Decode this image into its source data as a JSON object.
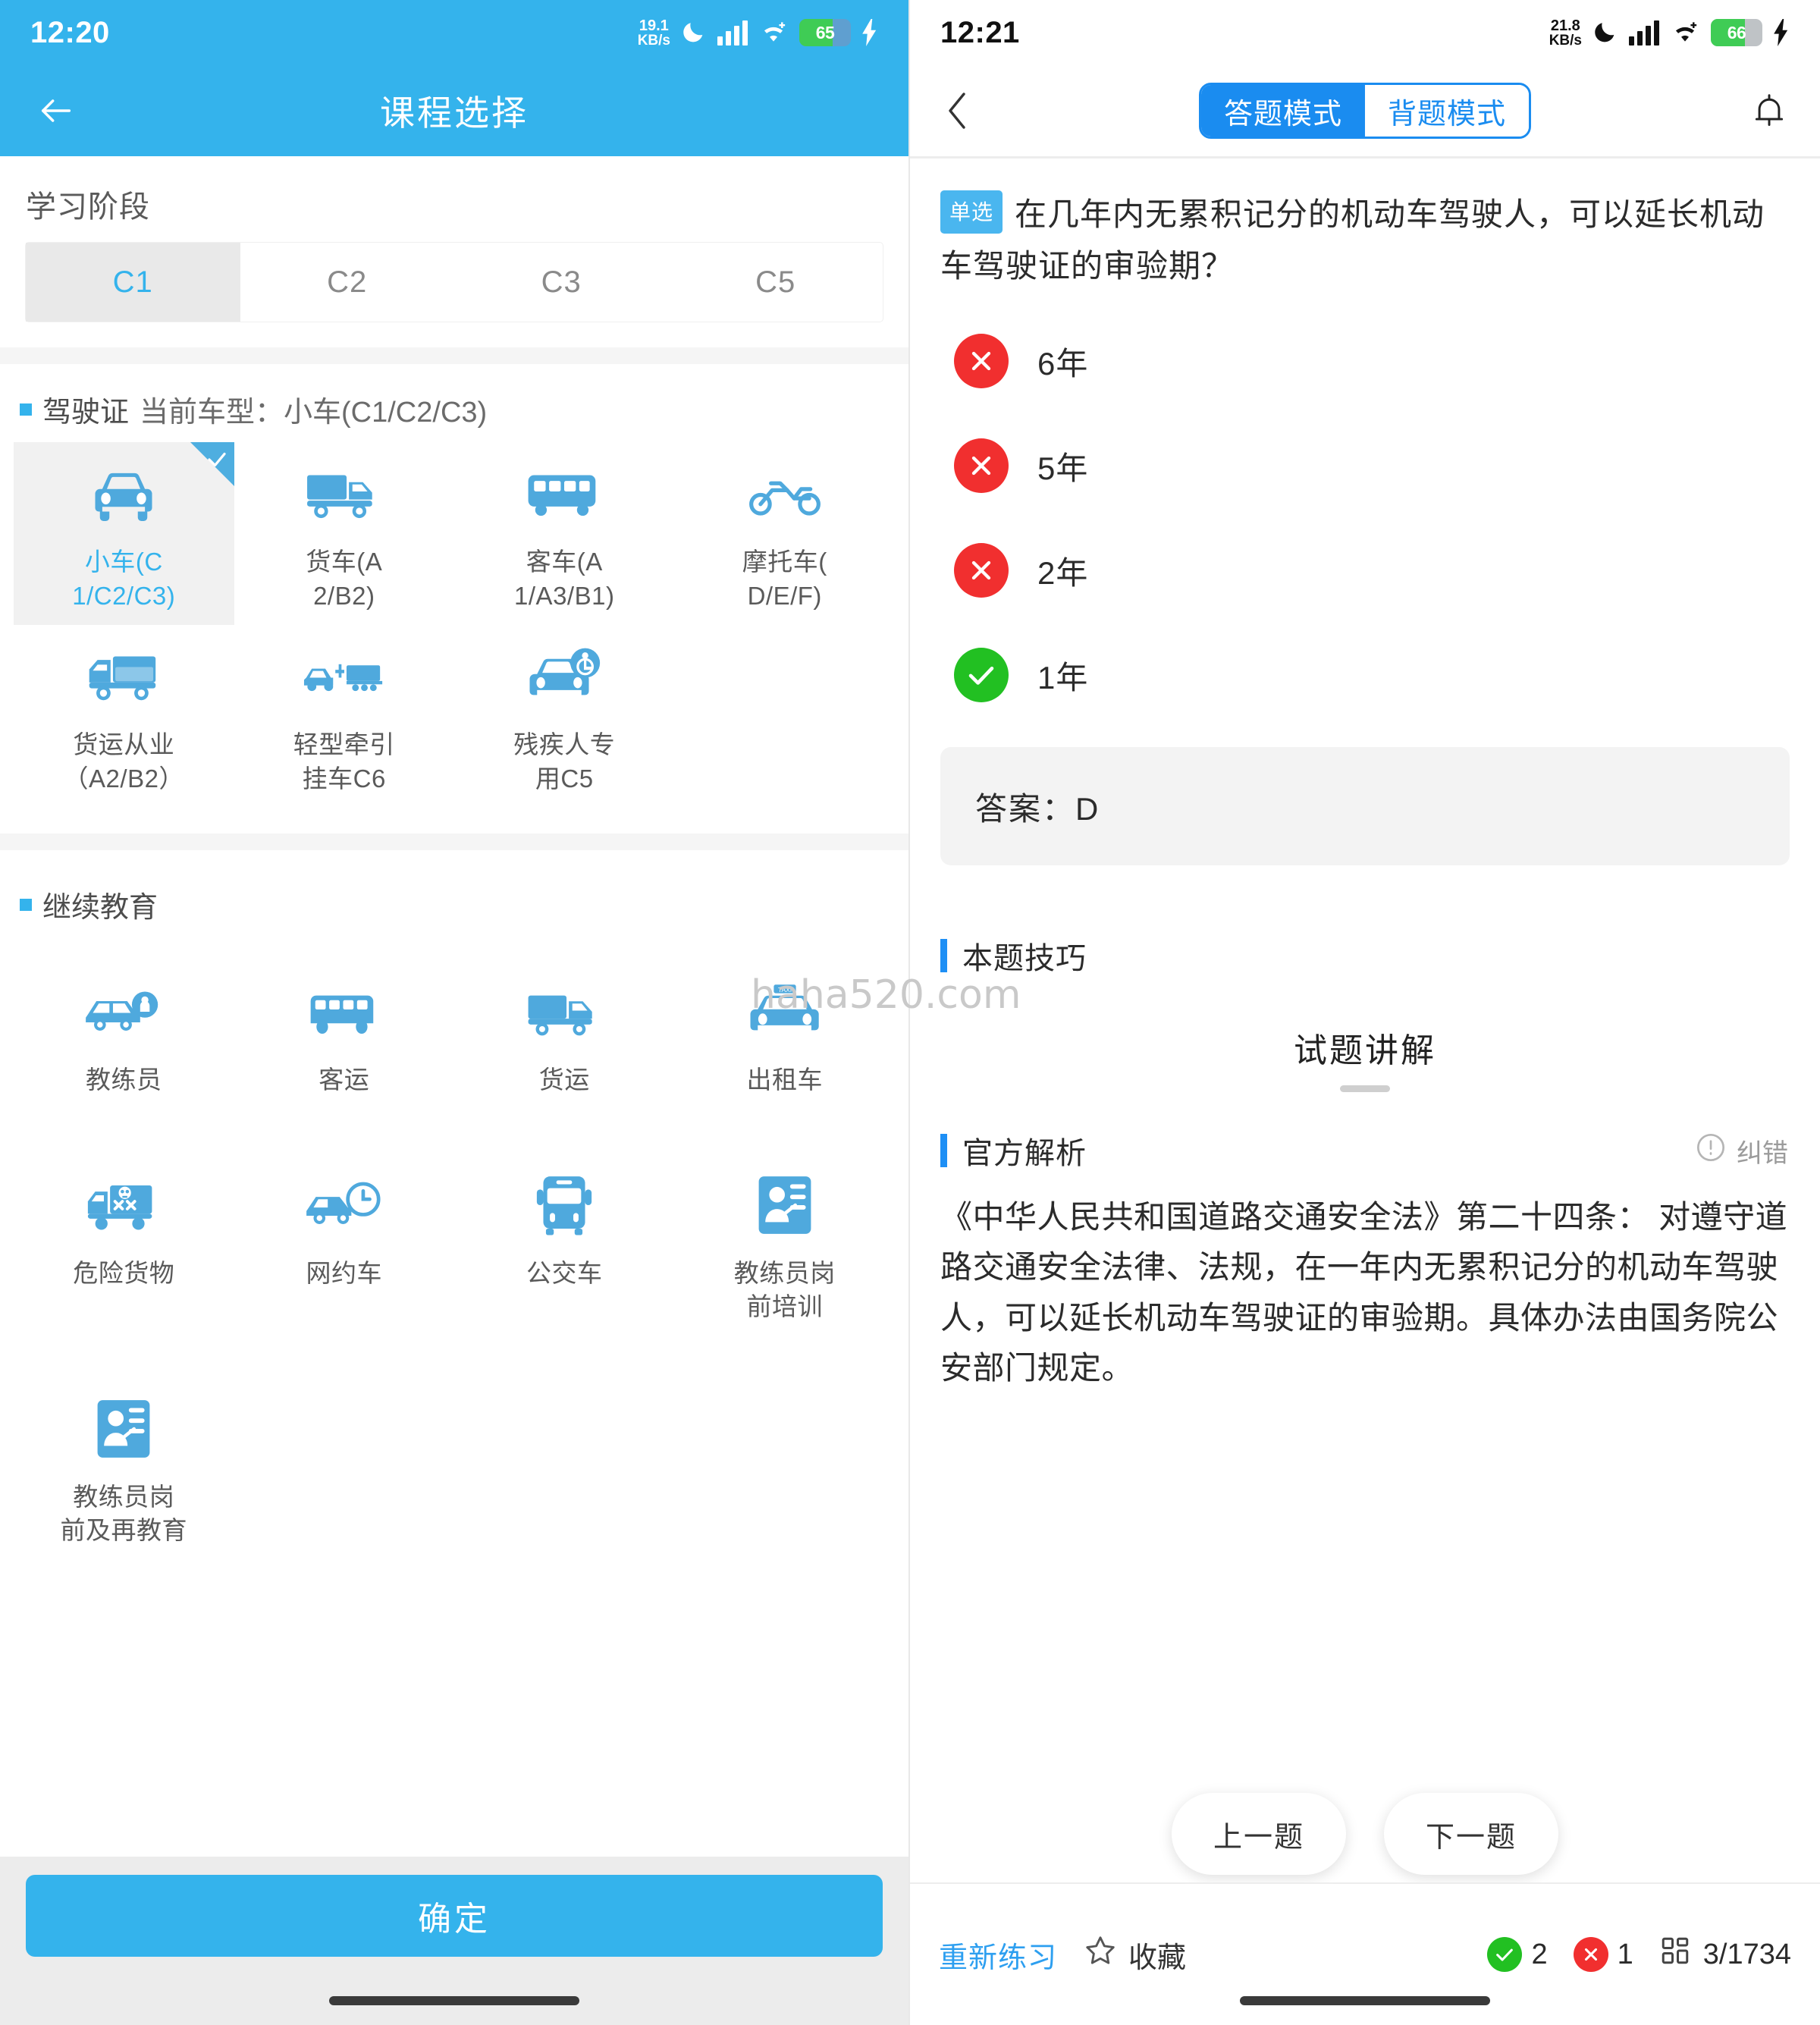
{
  "left": {
    "status": {
      "time": "12:20",
      "net_speed": "19.1",
      "net_unit": "KB/s",
      "battery": "65"
    },
    "appbar": {
      "title": "课程选择",
      "back_icon": "back-arrow-icon"
    },
    "stage": {
      "label": "学习阶段",
      "tabs": [
        {
          "label": "C1",
          "active": true
        },
        {
          "label": "C2",
          "active": false
        },
        {
          "label": "C3",
          "active": false
        },
        {
          "label": "C5",
          "active": false
        }
      ]
    },
    "license_section": {
      "title": "驾驶证",
      "subtitle": "当前车型：小车(C1/C2/C3)",
      "items": [
        {
          "line1": "小车(C",
          "line2": "1/C2/C3)",
          "icon": "car-icon",
          "selected": true
        },
        {
          "line1": "货车(A",
          "line2": "2/B2)",
          "icon": "truck-icon",
          "selected": false
        },
        {
          "line1": "客车(A",
          "line2": "1/A3/B1)",
          "icon": "bus-icon",
          "selected": false
        },
        {
          "line1": "摩托车(",
          "line2": "D/E/F)",
          "icon": "motorcycle-icon",
          "selected": false
        },
        {
          "line1": "货运从业",
          "line2": "（A2/B2）",
          "icon": "cargo-truck-icon",
          "selected": false
        },
        {
          "line1": "轻型牵引",
          "line2": "挂车C6",
          "icon": "car-trailer-icon",
          "selected": false
        },
        {
          "line1": "残疾人专",
          "line2": "用C5",
          "icon": "disabled-car-icon",
          "selected": false
        }
      ]
    },
    "continuing_section": {
      "title": "继续教育",
      "items": [
        {
          "line1": "教练员",
          "line2": "",
          "icon": "coach-car-icon"
        },
        {
          "line1": "客运",
          "line2": "",
          "icon": "coach-bus-icon"
        },
        {
          "line1": "货运",
          "line2": "",
          "icon": "freight-truck-icon"
        },
        {
          "line1": "出租车",
          "line2": "",
          "icon": "taxi-icon"
        },
        {
          "line1": "危险货物",
          "line2": "",
          "icon": "hazmat-truck-icon"
        },
        {
          "line1": "网约车",
          "line2": "",
          "icon": "ride-hailing-icon"
        },
        {
          "line1": "公交车",
          "line2": "",
          "icon": "city-bus-icon"
        },
        {
          "line1": "教练员岗",
          "line2": "前培训",
          "icon": "trainer-card-icon"
        },
        {
          "line1": "教练员岗",
          "line2": "前及再教育",
          "icon": "trainer-card-icon"
        }
      ]
    },
    "confirm_label": "确定"
  },
  "right": {
    "status": {
      "time": "12:21",
      "net_speed": "21.8",
      "net_unit": "KB/s",
      "battery": "66"
    },
    "nav": {
      "back_icon": "chevron-left-icon",
      "bell_icon": "bell-icon",
      "modes": [
        {
          "label": "答题模式",
          "active": true
        },
        {
          "label": "背题模式",
          "active": false
        }
      ]
    },
    "question": {
      "tag": "单选",
      "text": "在几年内无累积记分的机动车驾驶人，可以延长机动车驾驶证的审验期？",
      "options": [
        {
          "text": "6年",
          "state": "wrong"
        },
        {
          "text": "5年",
          "state": "wrong"
        },
        {
          "text": "2年",
          "state": "wrong"
        },
        {
          "text": "1年",
          "state": "right"
        }
      ],
      "answer_label": "答案：D"
    },
    "tips_heading": "本题技巧",
    "explain_title": "试题讲解",
    "official": {
      "heading": "官方解析",
      "report_label": "纠错",
      "report_icon": "warning-circle-icon",
      "text": "《中华人民共和国道路交通安全法》第二十四条： 对遵守道路交通安全法律、法规，在一年内无累积记分的机动车驾驶人，可以延长机动车驾驶证的审验期。具体办法由国务院公安部门规定。"
    },
    "nav_buttons": {
      "prev": "上一题",
      "next": "下一题"
    },
    "bottom": {
      "restart": "重新练习",
      "favorite": "收藏",
      "favorite_icon": "star-icon",
      "correct_count": "2",
      "wrong_count": "1",
      "pager": "3/1734",
      "pager_icon": "grid-icon"
    }
  },
  "watermark": "haha520.com",
  "colors": {
    "brand": "#34b3ec",
    "accent_blue": "#1a8cf0",
    "wrong": "#f12f2f",
    "right": "#22c022"
  }
}
